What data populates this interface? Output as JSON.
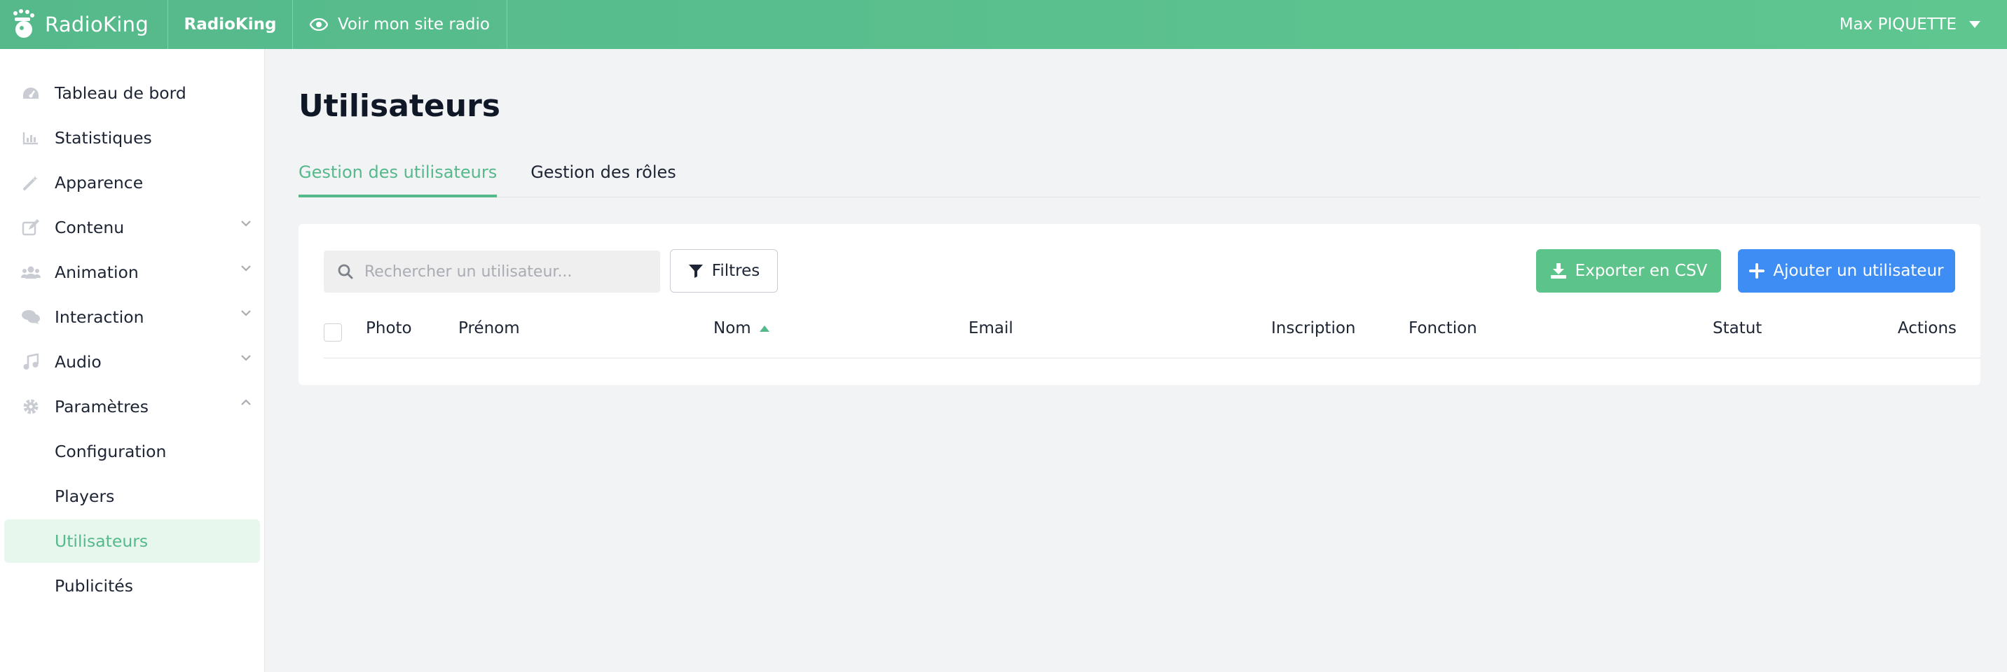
{
  "topbar": {
    "logo_text": "RadioKing",
    "site_name": "RadioKing",
    "view_site_label": "Voir mon site radio",
    "user_name": "Max PIQUETTE"
  },
  "sidebar": {
    "items": [
      {
        "label": "Tableau de bord",
        "icon": "dashboard-icon"
      },
      {
        "label": "Statistiques",
        "icon": "chart-icon"
      },
      {
        "label": "Apparence",
        "icon": "magic-wand-icon"
      },
      {
        "label": "Contenu",
        "icon": "edit-icon",
        "expandable": true
      },
      {
        "label": "Animation",
        "icon": "users-icon",
        "expandable": true
      },
      {
        "label": "Interaction",
        "icon": "comments-icon",
        "expandable": true
      },
      {
        "label": "Audio",
        "icon": "music-icon",
        "expandable": true
      },
      {
        "label": "Paramètres",
        "icon": "gear-icon",
        "expanded": true
      }
    ],
    "sub_items": [
      {
        "label": "Configuration"
      },
      {
        "label": "Players"
      },
      {
        "label": "Utilisateurs",
        "active": true
      },
      {
        "label": "Publicités"
      }
    ]
  },
  "main": {
    "title": "Utilisateurs",
    "tabs": [
      {
        "label": "Gestion des utilisateurs",
        "active": true
      },
      {
        "label": "Gestion des rôles"
      }
    ],
    "search": {
      "placeholder": "Rechercher un utilisateur..."
    },
    "filters_label": "Filtres",
    "export_label": "Exporter en CSV",
    "add_label": "Ajouter un utilisateur",
    "columns": [
      "Photo",
      "Prénom",
      "Nom",
      "Email",
      "Inscription",
      "Fonction",
      "Statut",
      "Actions"
    ],
    "sorted_column": "Nom"
  },
  "colors": {
    "brand_green": "#55b98b",
    "export_green": "#5cc48a",
    "primary_blue": "#3d8df5",
    "active_bg": "#e8f7ee"
  }
}
